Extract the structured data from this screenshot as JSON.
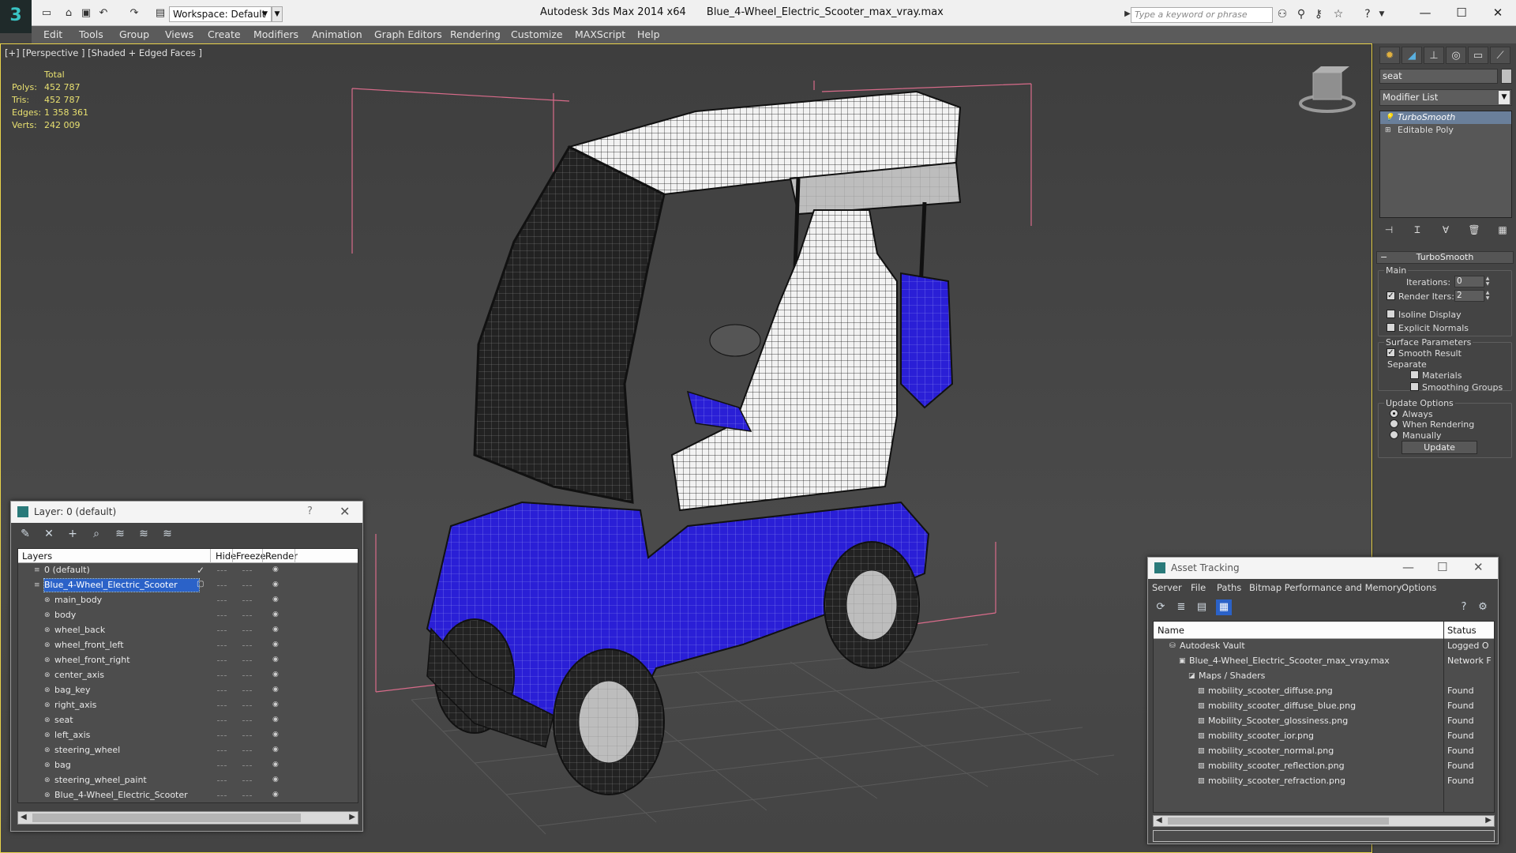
{
  "titlebar": {
    "workspace": "Workspace: Default",
    "app_name": "Autodesk 3ds Max  2014 x64",
    "file_name": "Blue_4-Wheel_Electric_Scooter_max_vray.max",
    "search_placeholder": "Type a keyword or phrase"
  },
  "menu": [
    "Edit",
    "Tools",
    "Group",
    "Views",
    "Create",
    "Modifiers",
    "Animation",
    "Graph Editors",
    "Rendering",
    "Customize",
    "MAXScript",
    "Help"
  ],
  "viewport": {
    "label": "[+] [Perspective ] [Shaded + Edged Faces ]",
    "stats": {
      "header": "Total",
      "rows": [
        {
          "key": "Polys:",
          "value": "452 787"
        },
        {
          "key": "Tris:",
          "value": "452 787"
        },
        {
          "key": "Edges:",
          "value": "1 358 361"
        },
        {
          "key": "Verts:",
          "value": "242 009"
        }
      ]
    }
  },
  "command_panel": {
    "object_name": "seat",
    "modifier_list": "Modifier List",
    "stack": [
      "TurboSmooth",
      "Editable Poly"
    ],
    "rollout_title": "TurboSmooth",
    "main_label": "Main",
    "iterations_label": "Iterations:",
    "iterations_value": "0",
    "render_iters_label": "Render Iters:",
    "render_iters_value": "2",
    "isoline_label": "Isoline Display",
    "explicit_normals_label": "Explicit Normals",
    "surface_params_label": "Surface Parameters",
    "smooth_result_label": "Smooth Result",
    "separate_label": "Separate",
    "materials_label": "Materials",
    "smoothing_groups_label": "Smoothing Groups",
    "update_options_label": "Update Options",
    "always_label": "Always",
    "when_rendering_label": "When Rendering",
    "manually_label": "Manually",
    "update_button": "Update"
  },
  "layer_dialog": {
    "title": "Layer: 0 (default)",
    "help": "?",
    "columns": {
      "layers": "Layers",
      "hide": "Hide",
      "freeze": "Freeze",
      "render": "Render"
    },
    "rows": [
      {
        "name": "0 (default)",
        "level": 0
      },
      {
        "name": "Blue_4-Wheel_Electric_Scooter",
        "level": 0
      },
      {
        "name": "main_body",
        "level": 1
      },
      {
        "name": "body",
        "level": 1
      },
      {
        "name": "wheel_back",
        "level": 1
      },
      {
        "name": "wheel_front_left",
        "level": 1
      },
      {
        "name": "wheel_front_right",
        "level": 1
      },
      {
        "name": "center_axis",
        "level": 1
      },
      {
        "name": "bag_key",
        "level": 1
      },
      {
        "name": "right_axis",
        "level": 1
      },
      {
        "name": "seat",
        "level": 1
      },
      {
        "name": "left_axis",
        "level": 1
      },
      {
        "name": "steering_wheel",
        "level": 1
      },
      {
        "name": "bag",
        "level": 1
      },
      {
        "name": "steering_wheel_paint",
        "level": 1
      },
      {
        "name": "Blue_4-Wheel_Electric_Scooter",
        "level": 1
      }
    ]
  },
  "asset_dialog": {
    "title": "Asset Tracking",
    "menu": [
      "Server",
      "File",
      "Paths",
      "Bitmap Performance and Memory",
      "Options"
    ],
    "columns": {
      "name": "Name",
      "status": "Status"
    },
    "rows": [
      {
        "name": "Autodesk Vault",
        "status": "Logged O",
        "level": 0
      },
      {
        "name": "Blue_4-Wheel_Electric_Scooter_max_vray.max",
        "status": "Network F",
        "level": 1
      },
      {
        "name": "Maps / Shaders",
        "status": "",
        "level": 2
      },
      {
        "name": "mobility_scooter_diffuse.png",
        "status": "Found",
        "level": 3
      },
      {
        "name": "mobility_scooter_diffuse_blue.png",
        "status": "Found",
        "level": 3
      },
      {
        "name": "Mobility_Scooter_glossiness.png",
        "status": "Found",
        "level": 3
      },
      {
        "name": "mobility_scooter_ior.png",
        "status": "Found",
        "level": 3
      },
      {
        "name": "mobility_scooter_normal.png",
        "status": "Found",
        "level": 3
      },
      {
        "name": "mobility_scooter_reflection.png",
        "status": "Found",
        "level": 3
      },
      {
        "name": "mobility_scooter_refraction.png",
        "status": "Found",
        "level": 3
      }
    ]
  },
  "colors": {
    "accent_blue": "#2b62c8",
    "viewport_border": "#e8d24a",
    "stats_text": "#e8e070",
    "scooter_blue": "#2a1fd6"
  }
}
